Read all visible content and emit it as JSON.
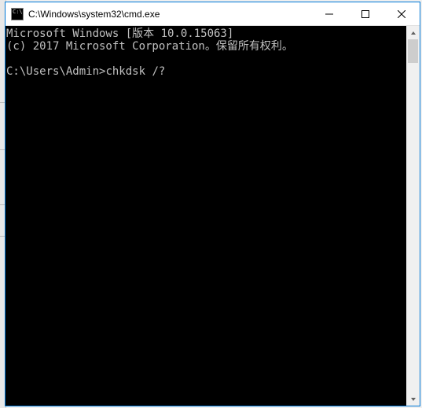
{
  "window": {
    "title": "C:\\Windows\\system32\\cmd.exe"
  },
  "console": {
    "line1": "Microsoft Windows [版本 10.0.15063]",
    "line2": "(c) 2017 Microsoft Corporation。保留所有权利。",
    "blank": "",
    "prompt": "C:\\Users\\Admin>",
    "command": "chkdsk /?"
  }
}
